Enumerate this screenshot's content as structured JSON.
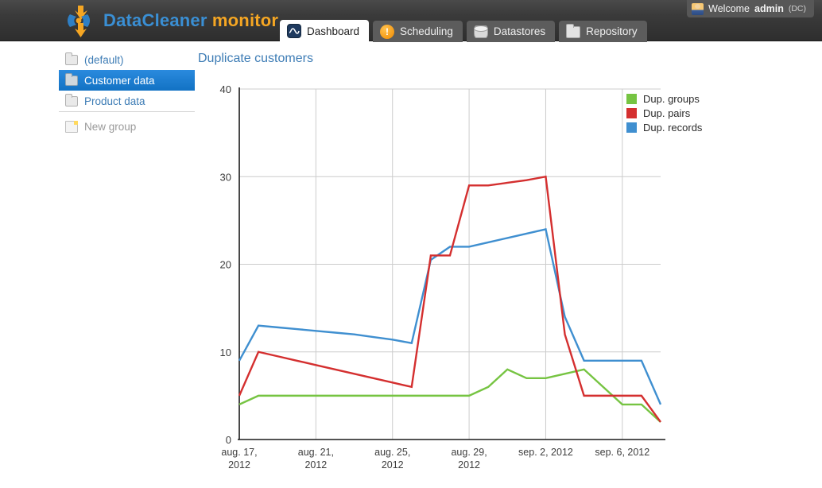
{
  "app": {
    "brand_primary": "DataCleaner",
    "brand_secondary": "monitor",
    "brand_primary_color": "#3a8fd4",
    "brand_secondary_color": "#f5a623"
  },
  "header": {
    "welcome_prefix": "Welcome",
    "welcome_user": "admin",
    "welcome_tenant": "(DC)",
    "avatar_icon": "user-avatar-icon"
  },
  "tabs": [
    {
      "label": "Dashboard",
      "icon": "dashboard-icon",
      "active": true
    },
    {
      "label": "Scheduling",
      "icon": "alert-icon",
      "active": false
    },
    {
      "label": "Datastores",
      "icon": "database-icon",
      "active": false
    },
    {
      "label": "Repository",
      "icon": "folder-icon",
      "active": false
    }
  ],
  "sidebar": {
    "items": [
      {
        "label": "(default)",
        "icon": "folder-closed-icon",
        "selected": false
      },
      {
        "label": "Customer data",
        "icon": "folder-open-icon",
        "selected": true
      },
      {
        "label": "Product data",
        "icon": "folder-closed-icon",
        "selected": false
      }
    ],
    "new_group": {
      "label": "New group",
      "icon": "new-page-icon"
    }
  },
  "main": {
    "panel_title": "Duplicate customers"
  },
  "chart_data": {
    "type": "line",
    "title": "Duplicate customers",
    "xlabel": "",
    "ylabel": "",
    "ylim": [
      0,
      40
    ],
    "yticks": [
      0,
      10,
      20,
      30,
      40
    ],
    "grid": true,
    "legend_position": "right",
    "tick_labels": [
      "aug. 17,\n2012",
      "aug. 21,\n2012",
      "aug. 25,\n2012",
      "aug. 29,\n2012",
      "sep. 2, 2012",
      "sep. 6, 2012"
    ],
    "tick_indices": [
      0,
      4,
      8,
      12,
      16,
      20
    ],
    "x": [
      "aug. 16, 2012",
      "aug. 17, 2012",
      "aug. 18, 2012",
      "aug. 19, 2012",
      "aug. 20, 2012",
      "aug. 21, 2012",
      "aug. 22, 2012",
      "aug. 23, 2012",
      "aug. 24, 2012",
      "aug. 25, 2012",
      "aug. 26, 2012",
      "aug. 27, 2012",
      "aug. 28, 2012",
      "aug. 29, 2012",
      "aug. 30, 2012",
      "aug. 31, 2012",
      "sep. 1, 2012",
      "sep. 2, 2012",
      "sep. 3, 2012",
      "sep. 4, 2012",
      "sep. 5, 2012",
      "sep. 6, 2012",
      "sep. 7, 2012"
    ],
    "series": [
      {
        "name": "Dup. groups",
        "color": "#76c442",
        "values": [
          4,
          5,
          5,
          5,
          5,
          5,
          5,
          5,
          5,
          5,
          5,
          5,
          5,
          6,
          8,
          7,
          7,
          7.5,
          8,
          6,
          4,
          4,
          2
        ]
      },
      {
        "name": "Dup. pairs",
        "color": "#d42f2f",
        "values": [
          5,
          10,
          9.5,
          9,
          8.5,
          8,
          7.5,
          7,
          6.5,
          6,
          21,
          21,
          29,
          29,
          29.3,
          29.6,
          30,
          12,
          5,
          5,
          5,
          5,
          2
        ]
      },
      {
        "name": "Dup. records",
        "color": "#3f8fd0",
        "values": [
          9,
          13,
          12.8,
          12.6,
          12.4,
          12.2,
          12,
          11.7,
          11.4,
          11,
          20.5,
          22,
          22,
          22.5,
          23,
          23.5,
          24,
          14,
          9,
          9,
          9,
          9,
          4
        ]
      }
    ]
  },
  "legend": [
    {
      "label": "Dup. groups",
      "color": "#76c442"
    },
    {
      "label": "Dup. pairs",
      "color": "#d42f2f"
    },
    {
      "label": "Dup. records",
      "color": "#3f8fd0"
    }
  ]
}
